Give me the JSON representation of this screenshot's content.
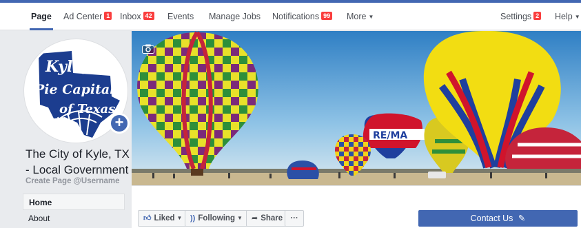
{
  "nav": {
    "items": [
      {
        "label": "Page",
        "badge": ""
      },
      {
        "label": "Ad Center",
        "badge": "1"
      },
      {
        "label": "Inbox",
        "badge": "42"
      },
      {
        "label": "Events",
        "badge": ""
      },
      {
        "label": "Manage Jobs",
        "badge": ""
      },
      {
        "label": "Notifications",
        "badge": "99"
      },
      {
        "label": "More",
        "badge": ""
      }
    ],
    "settings": {
      "label": "Settings",
      "badge": "2"
    },
    "help": {
      "label": "Help"
    }
  },
  "profile": {
    "logo_lines": [
      "Kyle,",
      "Pie Capital",
      "of Texas"
    ],
    "name": "The City of Kyle, TX - Local Government",
    "username_link": "Create Page @Username"
  },
  "side_menu": [
    "Home",
    "About"
  ],
  "actions": {
    "liked": "Liked",
    "following": "Following",
    "share": "Share",
    "more": "···"
  },
  "cta": {
    "label": "Contact Us"
  },
  "colors": {
    "brand": "#4267b2",
    "badge": "#fa3e3e"
  }
}
